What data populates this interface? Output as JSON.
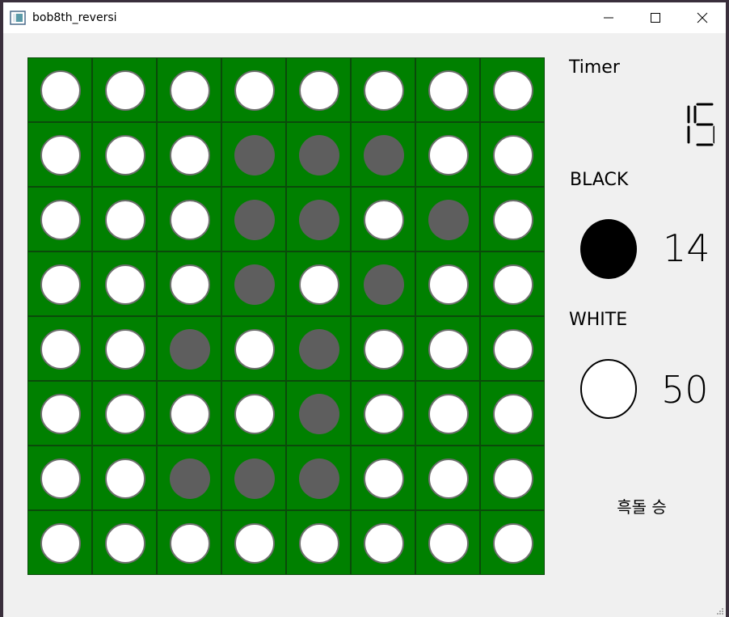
{
  "window": {
    "title": "bob8th_reversi"
  },
  "board": {
    "rows": [
      [
        "W",
        "W",
        "W",
        "W",
        "W",
        "W",
        "W",
        "W"
      ],
      [
        "W",
        "W",
        "W",
        "B",
        "B",
        "B",
        "W",
        "W"
      ],
      [
        "W",
        "W",
        "W",
        "B",
        "B",
        "W",
        "B",
        "W"
      ],
      [
        "W",
        "W",
        "W",
        "B",
        "W",
        "B",
        "W",
        "W"
      ],
      [
        "W",
        "W",
        "B",
        "W",
        "B",
        "W",
        "W",
        "W"
      ],
      [
        "W",
        "W",
        "W",
        "W",
        "B",
        "W",
        "W",
        "W"
      ],
      [
        "W",
        "W",
        "B",
        "B",
        "B",
        "W",
        "W",
        "W"
      ],
      [
        "W",
        "W",
        "W",
        "W",
        "W",
        "W",
        "W",
        "W"
      ]
    ]
  },
  "timer": {
    "label": "Timer",
    "value": "15"
  },
  "black": {
    "label": "BLACK",
    "count": "14"
  },
  "white": {
    "label": "WHITE",
    "count": "50"
  },
  "result_text": "흑돌 승"
}
